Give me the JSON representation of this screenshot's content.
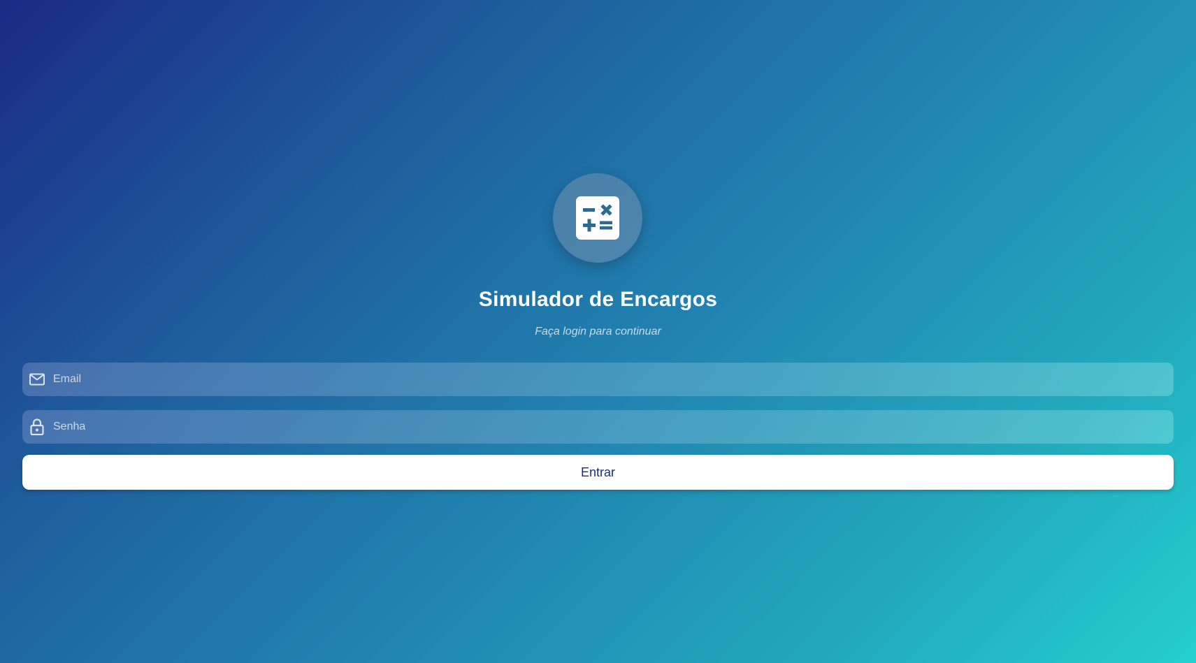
{
  "app": {
    "logo_icon": "calculator-icon",
    "title": "Simulador de Encargos",
    "subtitle": "Faça login para continuar"
  },
  "form": {
    "email": {
      "icon": "mail-icon",
      "placeholder": "Email",
      "value": ""
    },
    "password": {
      "icon": "lock-icon",
      "placeholder": "Senha",
      "value": ""
    },
    "submit_label": "Entrar"
  },
  "colors": {
    "gradient_start": "#1a2a86",
    "gradient_end": "#24cfcf",
    "button_background": "#ffffff",
    "button_text": "#1b2c7a",
    "icon_accent": "#2e6a8e"
  }
}
